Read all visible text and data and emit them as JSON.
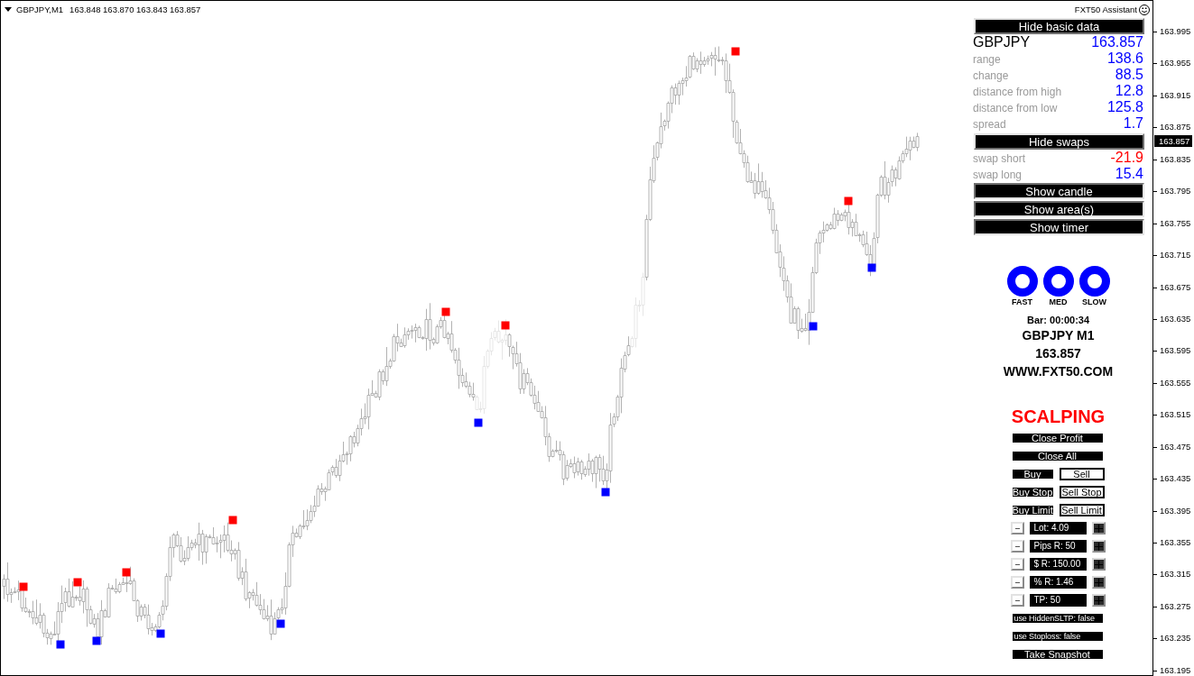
{
  "chart": {
    "symbol": "GBPJPY,M1",
    "quote": "163.848 163.870 163.843 163.857",
    "assistant_label": "FXT50 Assistant"
  },
  "basic_data": {
    "toggle": {
      "label": "Hide basic data",
      "pressed": false
    },
    "rows": [
      {
        "kind": "symbol",
        "label": "GBPJPY",
        "value": "163.857",
        "color": "#0000ff"
      },
      {
        "kind": "metric",
        "label": "range",
        "value": "138.6",
        "color": "#0000ff"
      },
      {
        "kind": "metric",
        "label": "change",
        "value": "88.5",
        "color": "#0000ff"
      },
      {
        "kind": "metric",
        "label": "distance from high",
        "value": "12.8",
        "color": "#0000ff"
      },
      {
        "kind": "metric",
        "label": "distance from low",
        "value": "125.8",
        "color": "#0000ff"
      },
      {
        "kind": "metric",
        "label": "spread",
        "value": "1.7",
        "color": "#0000ff"
      }
    ]
  },
  "swaps": {
    "toggle": {
      "label": "Hide swaps",
      "pressed": false
    },
    "rows": [
      {
        "label": "swap short",
        "value": "-21.9",
        "color": "#ff0000"
      },
      {
        "label": "swap long",
        "value": "15.4",
        "color": "#0000ff"
      }
    ]
  },
  "toggles": [
    {
      "label": "Show candle",
      "pressed": true
    },
    {
      "label": "Show area(s)",
      "pressed": true
    },
    {
      "label": "Show timer",
      "pressed": true
    }
  ],
  "signals": [
    {
      "label": "FAST",
      "color": "#0000ff"
    },
    {
      "label": "MED",
      "color": "#0000ff"
    },
    {
      "label": "SLOW",
      "color": "#0000ff"
    }
  ],
  "info": {
    "bar_timer": "Bar: 00:00:34",
    "symbol_timeframe": "GBPJPY M1",
    "price": "163.857",
    "website": "WWW.FXT50.COM"
  },
  "scalping": {
    "title": "SCALPING",
    "rows": [
      {
        "kind": "button",
        "label": "Close Profit"
      },
      {
        "kind": "button",
        "label": "Close All"
      },
      {
        "kind": "pair",
        "buttons": [
          {
            "kind": "buy",
            "label": "Buy"
          },
          {
            "kind": "sell",
            "label": "Sell"
          }
        ]
      },
      {
        "kind": "pair",
        "buttons": [
          {
            "kind": "buy",
            "label": "Buy Stop"
          },
          {
            "kind": "sell",
            "label": "Sell Stop"
          }
        ]
      },
      {
        "kind": "pair",
        "buttons": [
          {
            "kind": "buy",
            "label": "Buy Limit"
          },
          {
            "kind": "sell",
            "label": "Sell Limit"
          }
        ]
      },
      {
        "kind": "stepper",
        "value": "Lot: 4.09"
      },
      {
        "kind": "stepper",
        "value": "Pips R: 50"
      },
      {
        "kind": "stepper",
        "value": "$ R: 150.00"
      },
      {
        "kind": "stepper",
        "value": "% R: 1.46"
      },
      {
        "kind": "stepper",
        "value": "TP: 50"
      },
      {
        "kind": "setting",
        "label": "use HiddenSLTP: false"
      },
      {
        "kind": "setting",
        "label": "use Stoploss: false"
      },
      {
        "kind": "button",
        "label": "Take Snapshot"
      }
    ]
  },
  "price_axis": {
    "labels": [
      "163.995",
      "163.955",
      "163.915",
      "163.875",
      "163.835",
      "163.795",
      "163.755",
      "163.715",
      "163.675",
      "163.635",
      "163.595",
      "163.555",
      "163.515",
      "163.475",
      "163.435",
      "163.395",
      "163.355",
      "163.315",
      "163.275",
      "163.235",
      "163.195"
    ],
    "current_price": "163.857"
  }
}
